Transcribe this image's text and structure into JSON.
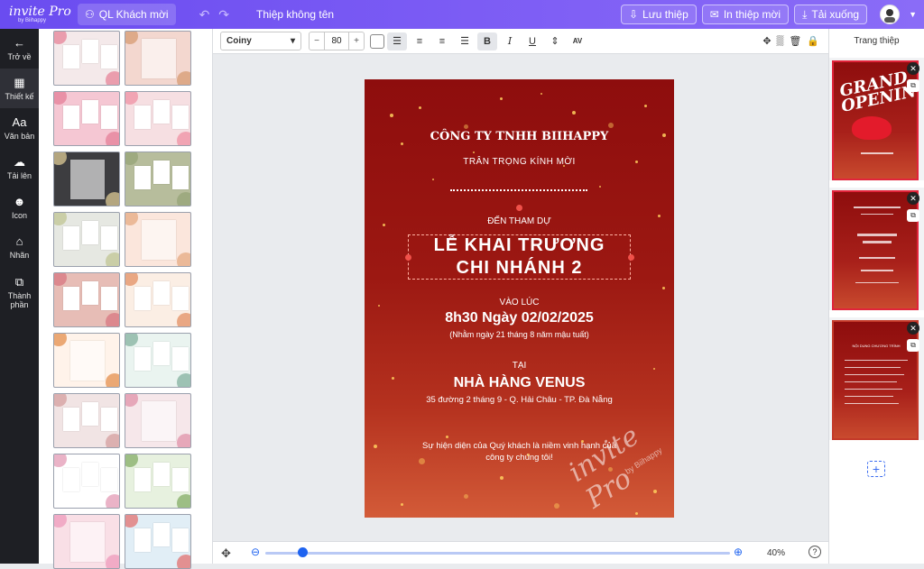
{
  "app": {
    "logo_text": "invite Pro",
    "logo_sub": "by Biihappy",
    "guest_button": "QL Khách mời",
    "doc_title": "Thiệp không tên",
    "save_label": "Lưu thiệp",
    "print_label": "In thiệp mời",
    "download_label": "Tải xuống"
  },
  "rail": [
    {
      "icon": "←",
      "label": "Trở về",
      "name": "back"
    },
    {
      "icon": "▦",
      "label": "Thiết kế",
      "name": "design"
    },
    {
      "icon": "Aa",
      "label": "Văn bản",
      "name": "text"
    },
    {
      "icon": "☁",
      "label": "Tải lên",
      "name": "upload"
    },
    {
      "icon": "☻",
      "label": "Icon",
      "name": "icon"
    },
    {
      "icon": "⌂",
      "label": "Nhãn",
      "name": "label"
    },
    {
      "icon": "⧉",
      "label": "Thành phần",
      "name": "components"
    }
  ],
  "toolbar": {
    "font": "Coiny",
    "font_size": "80",
    "minus": "−",
    "plus": "+"
  },
  "card": {
    "company": "CÔNG TY TNHH BIIHAPPY",
    "invite_line": "TRÂN TRỌNG KÍNH MỜI",
    "attend": "ĐẾN THAM DỰ",
    "event_line1": "LỄ KHAI TRƯƠNG",
    "event_line2": "CHI NHÁNH 2",
    "time_label": "VÀO LÚC",
    "time_value": "8h30 Ngày 02/02/2025",
    "lunar": "(Nhằm ngày 21 tháng 8 năm mậu tuất)",
    "at_label": "TẠI",
    "venue": "NHÀ HÀNG VENUS",
    "address": "35 đường 2 tháng 9 - Q. Hải Châu - TP. Đà Nẵng",
    "closing1": "Sự hiện diện của Quý khách là niềm vinh hạnh của",
    "closing2": "công ty chúng tôi!",
    "watermark": "invite Pro",
    "watermark_sub": "by Biihappy"
  },
  "zoom": {
    "value": "40%",
    "fraction": 0.08
  },
  "right_panel": {
    "title": "Trang thiệp",
    "page1_title": "GRAND OPENING",
    "page3_title": "NỘI DUNG CHƯƠNG TRÌNH"
  },
  "colors": {
    "brand": "#6a4cf0",
    "card_top": "#8e0d0d",
    "card_bottom": "#d35b38",
    "accent_blue": "#1e63f0"
  }
}
